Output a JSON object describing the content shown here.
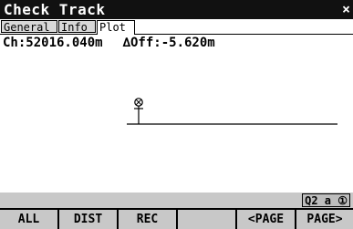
{
  "window": {
    "title": "Check Track",
    "close_glyph": "×"
  },
  "tabs": [
    {
      "label": "General",
      "active": false
    },
    {
      "label": "Info",
      "active": false
    },
    {
      "label": "Plot",
      "active": true
    }
  ],
  "readout": {
    "chainage": "Ch:52016.040m",
    "offset": "∆Off:-5.620m"
  },
  "plot": {
    "marker_icon": "crosshair-point-icon"
  },
  "status": {
    "quadrant": "Q2 a ①"
  },
  "fkeys": [
    "ALL",
    "DIST",
    "REC",
    "",
    "<PAGE",
    "PAGE>"
  ]
}
